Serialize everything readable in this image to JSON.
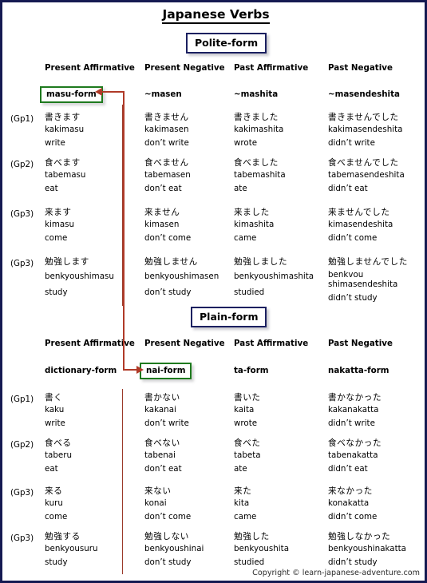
{
  "title": "Japanese Verbs",
  "footer": "Copyright © learn-japanese-adventure.com",
  "columns": [
    "Present Affirmative",
    "Present Negative",
    "Past Affirmative",
    "Past Negative"
  ],
  "sections": [
    {
      "name": "Polite-form",
      "form_labels": [
        "masu-form",
        "~masen",
        "~mashita",
        "~masendeshita"
      ],
      "highlight_index": 0,
      "rows": [
        {
          "group": "(Gp1)",
          "cells": [
            {
              "jp": "書きます",
              "romaji": "kakimasu",
              "meaning": "write"
            },
            {
              "jp": "書きません",
              "romaji": "kakimasen",
              "meaning": "don’t write"
            },
            {
              "jp": "書きました",
              "romaji": "kakimashita",
              "meaning": "wrote"
            },
            {
              "jp": "書きませんでした",
              "romaji": "kakimasendeshita",
              "meaning": "didn’t write"
            }
          ]
        },
        {
          "group": "(Gp2)",
          "cells": [
            {
              "jp": "食べます",
              "romaji": "tabemasu",
              "meaning": "eat"
            },
            {
              "jp": "食べません",
              "romaji": "tabemasen",
              "meaning": "don’t eat"
            },
            {
              "jp": "食べました",
              "romaji": "tabemashita",
              "meaning": "ate"
            },
            {
              "jp": "食べませんでした",
              "romaji": "tabemasendeshita",
              "meaning": "didn’t eat"
            }
          ]
        },
        {
          "group": "(Gp3)",
          "cells": [
            {
              "jp": "来ます",
              "romaji": "kimasu",
              "meaning": "come"
            },
            {
              "jp": "来ません",
              "romaji": "kimasen",
              "meaning": "don’t come"
            },
            {
              "jp": "来ました",
              "romaji": "kimashita",
              "meaning": "came"
            },
            {
              "jp": "来ませんでした",
              "romaji": "kimasendeshita",
              "meaning": "didn’t come"
            }
          ]
        },
        {
          "group": "(Gp3)",
          "cells": [
            {
              "jp": "勉強します",
              "romaji": "benkyoushimasu",
              "meaning": "study"
            },
            {
              "jp": "勉強しません",
              "romaji": "benkyoushimasen",
              "meaning": "don’t study"
            },
            {
              "jp": "勉強しました",
              "romaji": "benkyoushimashita",
              "meaning": "studied"
            },
            {
              "jp": "勉強しませんでした",
              "romaji": "benkvou shimasendeshita",
              "meaning": "didn’t study",
              "wrap": true
            }
          ]
        }
      ]
    },
    {
      "name": "Plain-form",
      "form_labels": [
        "dictionary-form",
        "nai-form",
        "ta-form",
        "nakatta-form"
      ],
      "highlight_index": 1,
      "rows": [
        {
          "group": "(Gp1)",
          "cells": [
            {
              "jp": "書く",
              "romaji": "kaku",
              "meaning": "write"
            },
            {
              "jp": "書かない",
              "romaji": "kakanai",
              "meaning": "don’t write"
            },
            {
              "jp": "書いた",
              "romaji": "kaita",
              "meaning": "wrote"
            },
            {
              "jp": "書かなかった",
              "romaji": "kakanakatta",
              "meaning": "didn’t write"
            }
          ]
        },
        {
          "group": "(Gp2)",
          "cells": [
            {
              "jp": "食べる",
              "romaji": "taberu",
              "meaning": "eat"
            },
            {
              "jp": "食べない",
              "romaji": "tabenai",
              "meaning": "don’t eat"
            },
            {
              "jp": "食べた",
              "romaji": "tabeta",
              "meaning": "ate"
            },
            {
              "jp": "食べなかった",
              "romaji": "tabenakatta",
              "meaning": "didn’t eat"
            }
          ]
        },
        {
          "group": "(Gp3)",
          "cells": [
            {
              "jp": "来る",
              "romaji": "kuru",
              "meaning": "come"
            },
            {
              "jp": "来ない",
              "romaji": "konai",
              "meaning": "don’t come"
            },
            {
              "jp": "来た",
              "romaji": "kita",
              "meaning": "came"
            },
            {
              "jp": "来なかった",
              "romaji": "konakatta",
              "meaning": "didn’t come"
            }
          ]
        },
        {
          "group": "(Gp3)",
          "cells": [
            {
              "jp": "勉強する",
              "romaji": "benkyousuru",
              "meaning": "study"
            },
            {
              "jp": "勉強しない",
              "romaji": "benkyoushinai",
              "meaning": "don’t study"
            },
            {
              "jp": "勉強した",
              "romaji": "benkyoushita",
              "meaning": "studied"
            },
            {
              "jp": "勉強しなかった",
              "romaji": "benkyoushinakatta",
              "meaning": "didn’t study"
            }
          ]
        }
      ]
    }
  ],
  "colors": {
    "page_border": "#151a52",
    "section_box_border": "#1b2060",
    "highlight_box_border": "#1e7a1e",
    "arrow": "#b03a28",
    "separator": "#9b3a2a"
  }
}
